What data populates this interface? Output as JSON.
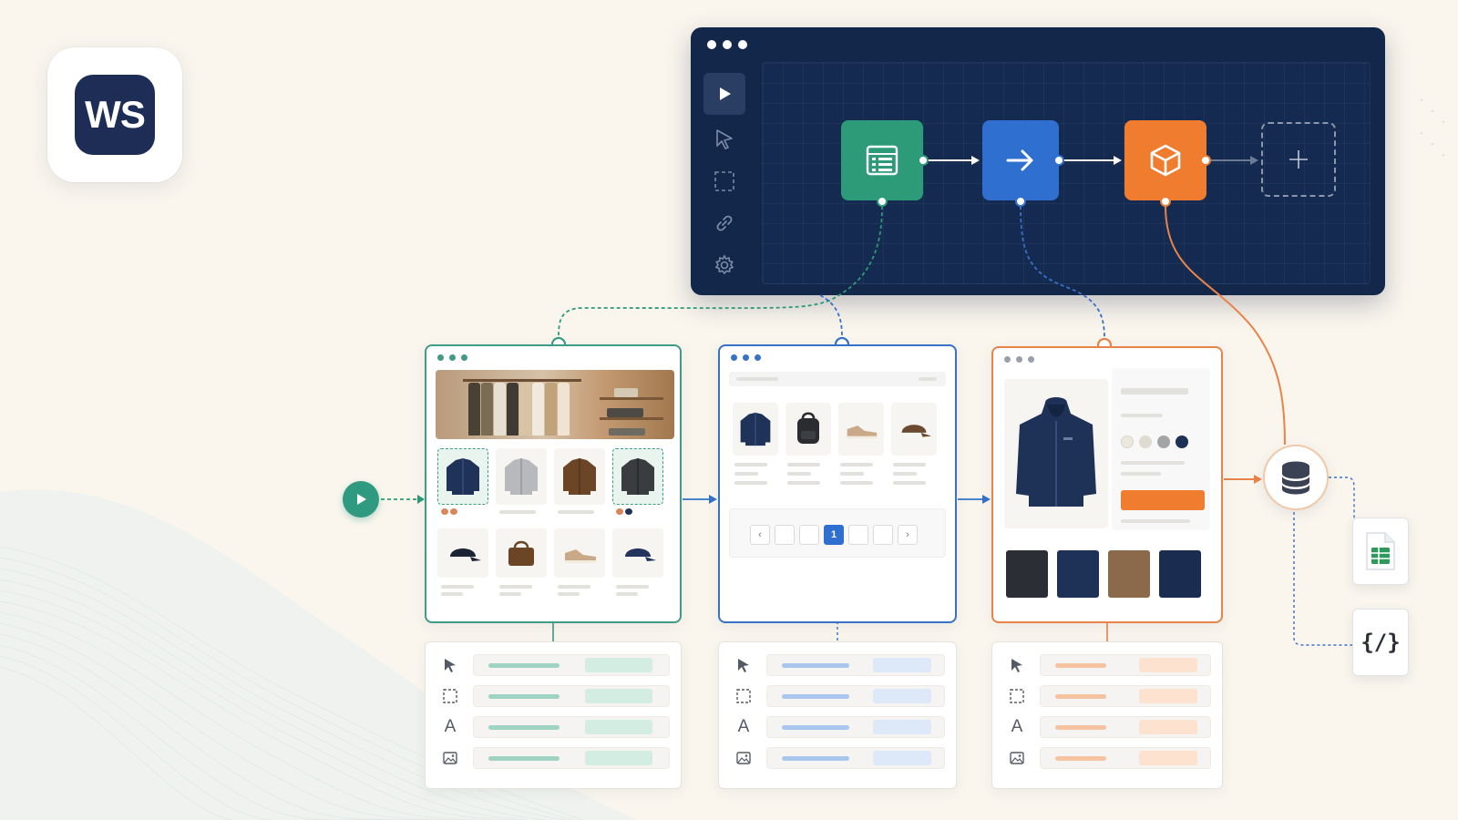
{
  "logo": {
    "text": "WS"
  },
  "editor": {
    "tools": [
      "play-icon",
      "cursor-icon",
      "select-box-icon",
      "link-icon",
      "gear-icon"
    ],
    "nodes": [
      {
        "name": "list-node",
        "icon": "list-icon",
        "color": "#2d9a78"
      },
      {
        "name": "navigate-node",
        "icon": "arrow-right-icon",
        "color": "#2e6fd0"
      },
      {
        "name": "cube-node",
        "icon": "cube-icon",
        "color": "#f07c30"
      },
      {
        "name": "add-node",
        "icon": "plus-icon"
      }
    ]
  },
  "pages": {
    "category": {
      "accent": "#3f9a86"
    },
    "listing": {
      "accent": "#3572c8",
      "pagination": [
        "‹",
        "",
        "",
        "1",
        "",
        "",
        "›"
      ]
    },
    "product": {
      "accent": "#e88449"
    }
  },
  "outputs": [
    "database-icon",
    "spreadsheet-icon",
    "json-file-icon"
  ],
  "json_file": {
    "glyph": "{/}"
  },
  "fields": [
    {
      "icon": "cursor-icon"
    },
    {
      "icon": "select-box-icon"
    },
    {
      "icon": "text-icon",
      "letter": "A"
    },
    {
      "icon": "image-icon"
    }
  ]
}
